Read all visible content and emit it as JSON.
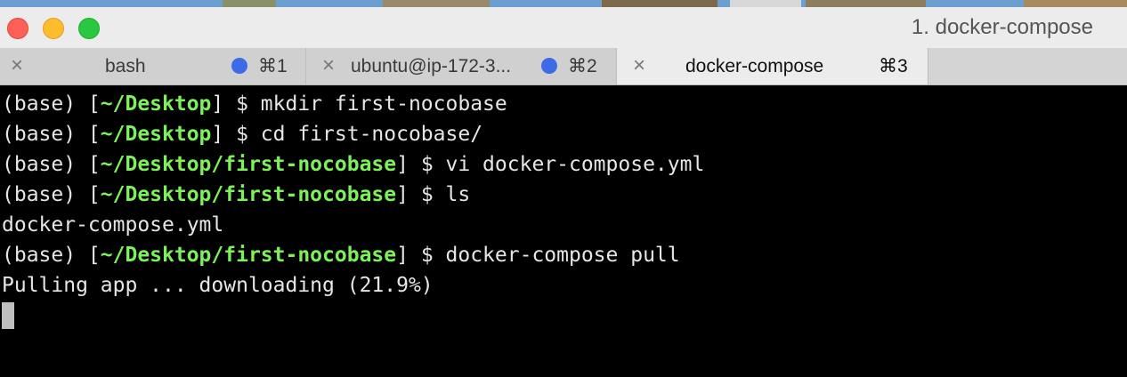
{
  "window": {
    "title": "1. docker-compose"
  },
  "tabs": [
    {
      "label": "bash",
      "shortcut": "⌘1",
      "close_icon": "×",
      "has_activity": true,
      "active": false
    },
    {
      "label": "ubuntu@ip-172-3...",
      "shortcut": "⌘2",
      "close_icon": "×",
      "has_activity": true,
      "active": false
    },
    {
      "label": "docker-compose",
      "shortcut": "⌘3",
      "close_icon": "×",
      "has_activity": false,
      "active": true
    }
  ],
  "terminal": {
    "lines": [
      {
        "prefix": "(base) [",
        "path": "~/Desktop",
        "suffix": "] $ mkdir first-nocobase"
      },
      {
        "prefix": "(base) [",
        "path": "~/Desktop",
        "suffix": "] $ cd first-nocobase/"
      },
      {
        "prefix": "(base) [",
        "path": "~/Desktop/first-nocobase",
        "suffix": "] $ vi docker-compose.yml"
      },
      {
        "prefix": "(base) [",
        "path": "~/Desktop/first-nocobase",
        "suffix": "] $ ls"
      },
      {
        "text": "docker-compose.yml"
      },
      {
        "prefix": "(base) [",
        "path": "~/Desktop/first-nocobase",
        "suffix": "] $ docker-compose pull"
      },
      {
        "text": "Pulling app ... downloading (21.9%)"
      }
    ]
  },
  "colors": {
    "path": "#7cf15a",
    "activity_dot": "#3d6be8",
    "close_red": "#fe5f57",
    "minimize_yellow": "#febc2e",
    "zoom_green": "#28c840"
  }
}
